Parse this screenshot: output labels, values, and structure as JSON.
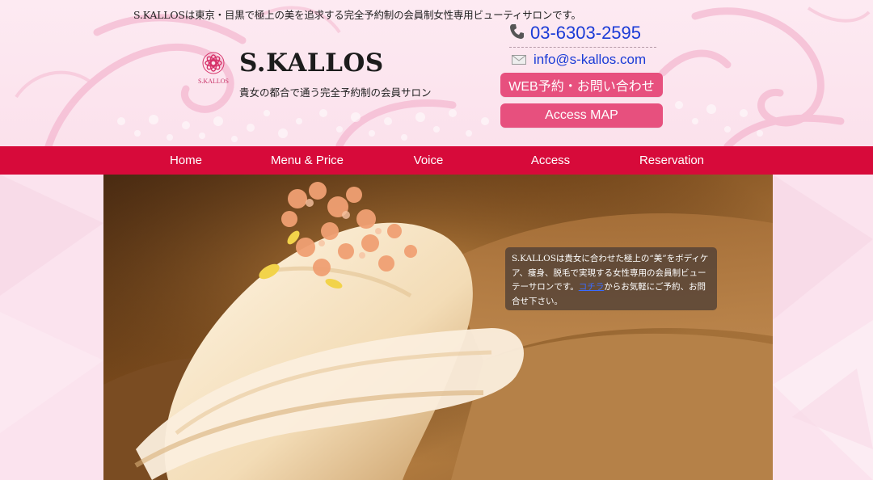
{
  "header": {
    "tagline": "S.KALLOSは東京・目黒で極上の美を追求する完全予約制の会員制女性専用ビューティサロンです。",
    "logo_small_text": "S.KALLOS",
    "title": "S.KALLOS",
    "subtitle": "貴女の都合で通う完全予約制の会員サロン",
    "phone": "03-6303-2595",
    "email": "info@s-kallos.com",
    "web_button": "WEB予約・お問い合わせ",
    "map_button": "Access MAP"
  },
  "nav": {
    "items": [
      "Home",
      "Menu & Price",
      "Voice",
      "Access",
      "Reservation"
    ]
  },
  "hero": {
    "caption_before": "S.KALLOSは貴女に合わせた極上の“美”をボディケア、痩身、脱毛で実現する女性専用の会員制ビューテーサロンです。",
    "caption_link": "コチラ",
    "caption_after": "からお気軽にご予約、お問合せ下さい。"
  },
  "colors": {
    "brand_pink": "#e7507e",
    "nav_red": "#d70a3a",
    "link_blue": "#1a3bd6",
    "header_bg": "#fdeaf2"
  },
  "icons": {
    "phone": "phone-icon",
    "email": "envelope-icon",
    "logo": "flower-logo-icon"
  }
}
